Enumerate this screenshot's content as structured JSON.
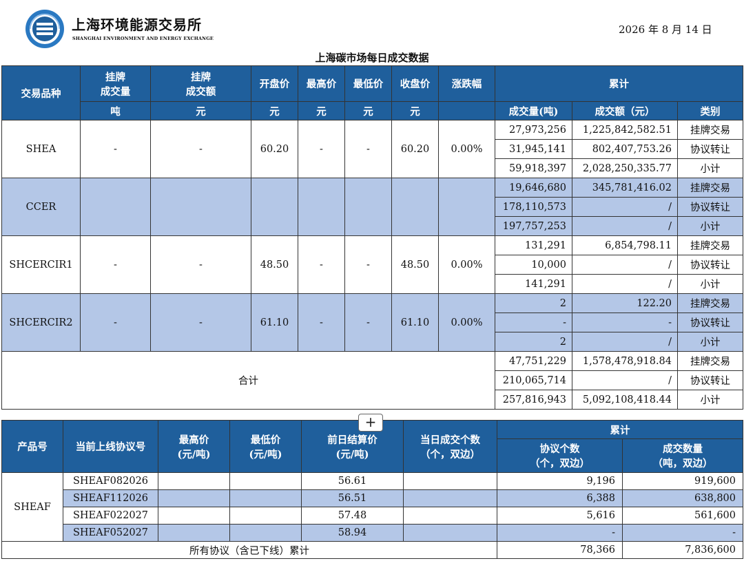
{
  "header": {
    "org_cn": "上海环境能源交易所",
    "org_en": "SHANGHAI ENVIRONMENT AND ENERGY EXCHANGE",
    "date": "2026 年 8 月 14 日",
    "title": "上海碳市场每日成交数据"
  },
  "colors": {
    "header_bg": "#1f5f9c",
    "band_bg": "#b4c7e7"
  },
  "table1": {
    "headers": {
      "product": "交易品种",
      "listed_vol_1": "挂牌",
      "listed_vol_2": "成交量",
      "listed_amt_1": "挂牌",
      "listed_amt_2": "成交额",
      "open": "开盘价",
      "high": "最高价",
      "low": "最低价",
      "close": "收盘价",
      "change": "涨跌幅",
      "cumulative": "累计",
      "unit_ton": "吨",
      "unit_yuan": "元",
      "cum_vol": "成交量(吨)",
      "cum_amt": "成交额（元）",
      "category": "类别"
    },
    "rows": [
      {
        "product": "SHEA",
        "listed_vol": "-",
        "listed_amt": "-",
        "open": "60.20",
        "high": "-",
        "low": "-",
        "close": "60.20",
        "change": "0.00%",
        "details": [
          {
            "vol": "27,973,256",
            "amt": "1,225,842,582.51",
            "category": "挂牌交易"
          },
          {
            "vol": "31,945,141",
            "amt": "802,407,753.26",
            "category": "协议转让"
          },
          {
            "vol": "59,918,397",
            "amt": "2,028,250,335.77",
            "category": "小计"
          }
        ]
      },
      {
        "product": "CCER",
        "listed_vol": "",
        "listed_amt": "",
        "open": "",
        "high": "",
        "low": "",
        "close": "",
        "change": "",
        "details": [
          {
            "vol": "19,646,680",
            "amt": "345,781,416.02",
            "category": "挂牌交易"
          },
          {
            "vol": "178,110,573",
            "amt": "/",
            "category": "协议转让"
          },
          {
            "vol": "197,757,253",
            "amt": "/",
            "category": "小计"
          }
        ]
      },
      {
        "product": "SHCERCIR1",
        "listed_vol": "-",
        "listed_amt": "-",
        "open": "48.50",
        "high": "-",
        "low": "-",
        "close": "48.50",
        "change": "0.00%",
        "details": [
          {
            "vol": "131,291",
            "amt": "6,854,798.11",
            "category": "挂牌交易"
          },
          {
            "vol": "10,000",
            "amt": "/",
            "category": "协议转让"
          },
          {
            "vol": "141,291",
            "amt": "/",
            "category": "小计"
          }
        ]
      },
      {
        "product": "SHCERCIR2",
        "listed_vol": "-",
        "listed_amt": "-",
        "open": "61.10",
        "high": "-",
        "low": "-",
        "close": "61.10",
        "change": "0.00%",
        "details": [
          {
            "vol": "2",
            "amt": "122.20",
            "category": "挂牌交易"
          },
          {
            "vol": "-",
            "amt": "-",
            "category": "协议转让"
          },
          {
            "vol": "2",
            "amt": "/",
            "category": "小计"
          }
        ]
      }
    ],
    "total": {
      "label": "合计",
      "details": [
        {
          "vol": "47,751,229",
          "amt": "1,578,478,918.84",
          "category": "挂牌交易"
        },
        {
          "vol": "210,065,714",
          "amt": "/",
          "category": "协议转让"
        },
        {
          "vol": "257,816,943",
          "amt": "5,092,108,418.44",
          "category": "小计"
        }
      ]
    }
  },
  "expand_button": "+",
  "table2": {
    "headers": {
      "product_no": "产品号",
      "contract": "当前上线协议号",
      "high_1": "最高价",
      "high_2": "(元/吨)",
      "low_1": "最低价",
      "low_2": "(元/吨)",
      "settle_1": "前日结算价",
      "settle_2": "(元/吨)",
      "count_1": "当日成交个数",
      "count_2": "（个，双边）",
      "cumulative": "累计",
      "agree_1": "协议个数",
      "agree_2": "（个，双边）",
      "qty_1": "成交数量",
      "qty_2": "（吨，双边）"
    },
    "product": "SHEAF",
    "rows": [
      {
        "contract": "SHEAF082026",
        "high": "",
        "low": "",
        "settle": "56.61",
        "count": "",
        "agree": "9,196",
        "qty": "919,600"
      },
      {
        "contract": "SHEAF112026",
        "high": "",
        "low": "",
        "settle": "56.51",
        "count": "",
        "agree": "6,388",
        "qty": "638,800"
      },
      {
        "contract": "SHEAF022027",
        "high": "",
        "low": "",
        "settle": "57.48",
        "count": "",
        "agree": "5,616",
        "qty": "561,600"
      },
      {
        "contract": "SHEAF052027",
        "high": "",
        "low": "",
        "settle": "58.94",
        "count": "",
        "agree": "-",
        "qty": "-"
      }
    ],
    "total": {
      "label": "所有协议（含已下线）累计",
      "agree": "78,366",
      "qty": "7,836,600"
    }
  }
}
